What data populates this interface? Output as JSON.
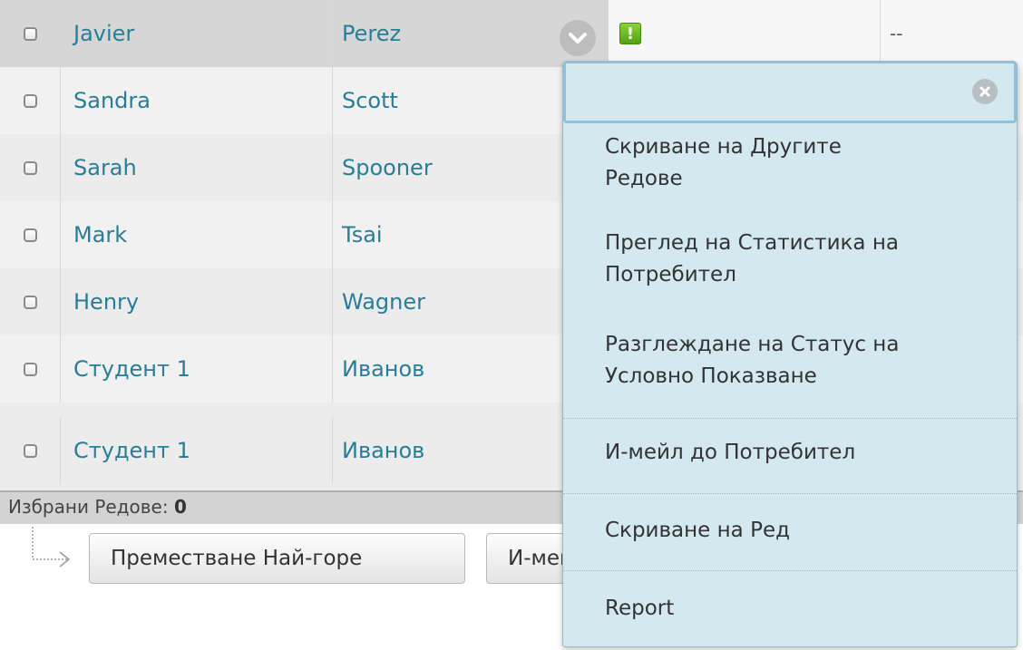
{
  "rows": [
    {
      "first": "Javier",
      "last": "Perez",
      "status_extra": "--"
    },
    {
      "first": "Sandra",
      "last": "Scott"
    },
    {
      "first": "Sarah",
      "last": "Spooner"
    },
    {
      "first": "Mark",
      "last": "Tsai"
    },
    {
      "first": "Henry",
      "last": "Wagner"
    },
    {
      "first": "Студент 1",
      "last": "Иванов"
    },
    {
      "first": "Студент 1",
      "last": "Иванов"
    }
  ],
  "footer": {
    "selected_label": "Избрани Редове:",
    "selected_count": "0"
  },
  "buttons": {
    "move_top": "Преместване Най-горе",
    "email": "И-мейл до Потребител"
  },
  "menu": {
    "items": [
      {
        "line1": "Скриване на Другите",
        "line2": "Редове"
      },
      {
        "line1": "Преглед на Статистика на",
        "line2": "Потребител"
      },
      {
        "line1": "Разглеждане на Статус на",
        "line2": "Условно Показване"
      },
      {
        "line1": "И-мейл до Потребител"
      },
      {
        "line1": "Скриване на Ред"
      },
      {
        "line1": "Report"
      }
    ]
  },
  "colors": {
    "link": "#2a7d96",
    "menu_bg": "#d4e8f0",
    "alert": "#5fb320"
  },
  "icons": {
    "row_menu": "chevron-down-icon",
    "status": "exclamation-alert-icon",
    "menu_close": "close-icon"
  }
}
